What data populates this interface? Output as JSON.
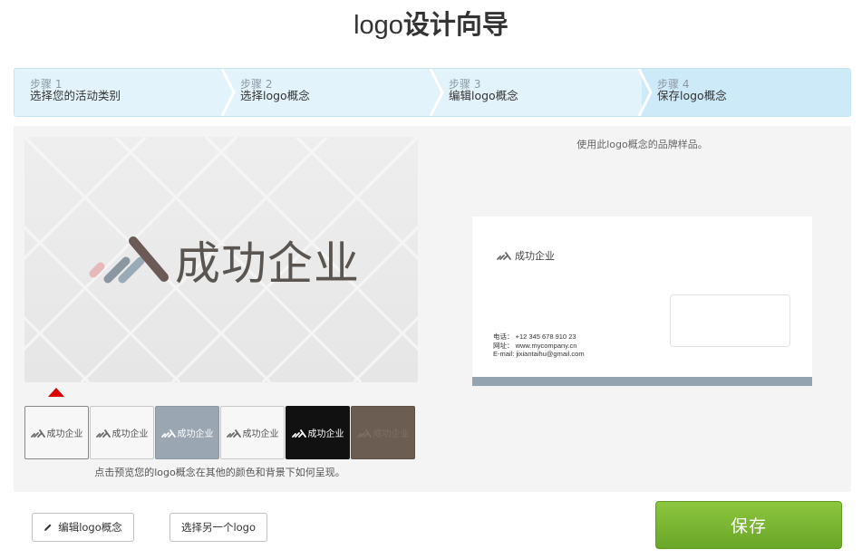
{
  "header": {
    "title_prefix": "logo",
    "title_rest": "设计向导"
  },
  "steps": [
    {
      "num": "步骤 1",
      "label": "选择您的活动类别"
    },
    {
      "num": "步骤 2",
      "label": "选择logo概念"
    },
    {
      "num": "步骤 3",
      "label": "编辑logo概念"
    },
    {
      "num": "步骤 4",
      "label": "保存logo概念"
    }
  ],
  "preview": {
    "company_name": "成功企业"
  },
  "swatches": [
    {
      "label": "成功企业",
      "bg": "#f7f7f7",
      "fg": "#555555"
    },
    {
      "label": "成功企业",
      "bg": "#f7f7f7",
      "fg": "#555555"
    },
    {
      "label": "成功企业",
      "bg": "#9aa6b1",
      "fg": "#ffffff"
    },
    {
      "label": "成功企业",
      "bg": "#f7f7f7",
      "fg": "#555555"
    },
    {
      "label": "成功企业",
      "bg": "#111111",
      "fg": "#ffffff"
    },
    {
      "label": "成功企业",
      "bg": "#6b5d52",
      "fg": "#7d6f63"
    }
  ],
  "hint": "点击预览您的logo概念在其他的颜色和背景下如何呈现。",
  "sample_note": "使用此logo概念的品牌样品。",
  "card": {
    "company_name": "成功企业",
    "phone_label": "电话：",
    "phone": "+12 345 678 910 23",
    "web_label": "网址：",
    "web": "www.mycompany.cn",
    "email_label": "E-mail:",
    "email": "jixiantaihu@gmail.com"
  },
  "buttons": {
    "edit": "编辑logo概念",
    "choose_other": "选择另一个logo",
    "save": "保存"
  },
  "colors": {
    "accent_green": "#7ab833",
    "step_bg": "#e3f3fb",
    "step_active_bg": "#cdeaf8",
    "marker_red": "#d80000",
    "card_bar": "#94a3b0"
  }
}
